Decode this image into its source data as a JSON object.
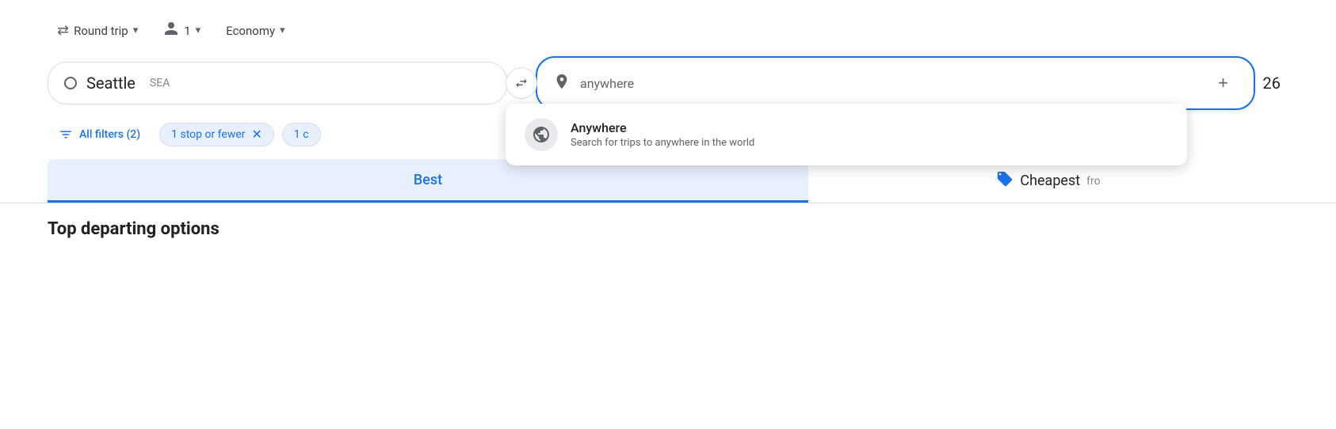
{
  "topbar": {
    "trip_type_label": "Round trip",
    "passengers_count": "1",
    "class_label": "Economy"
  },
  "search": {
    "origin_city": "Seattle",
    "origin_code": "SEA",
    "destination_placeholder": "anywhere",
    "plus_label": "+",
    "date_number": "26",
    "swap_icon": "⇄"
  },
  "dropdown": {
    "anywhere_title": "Anywhere",
    "anywhere_subtitle": "Search for trips to anywhere in the world"
  },
  "filters": {
    "all_filters_label": "All filters (2)",
    "stop_chip_label": "1 stop or fewer",
    "partial_chip_label": "1 c"
  },
  "tabs": {
    "best_label": "Best",
    "cheapest_label": "Cheapest",
    "cheapest_from": "fro"
  },
  "bottom": {
    "heading": "Top departing options"
  },
  "icons": {
    "arrows": "⇄",
    "chevron": "▾",
    "person": "👤",
    "pin": "📍",
    "globe": "🌐",
    "filter_sliders": "⊟",
    "tag": "🏷"
  }
}
